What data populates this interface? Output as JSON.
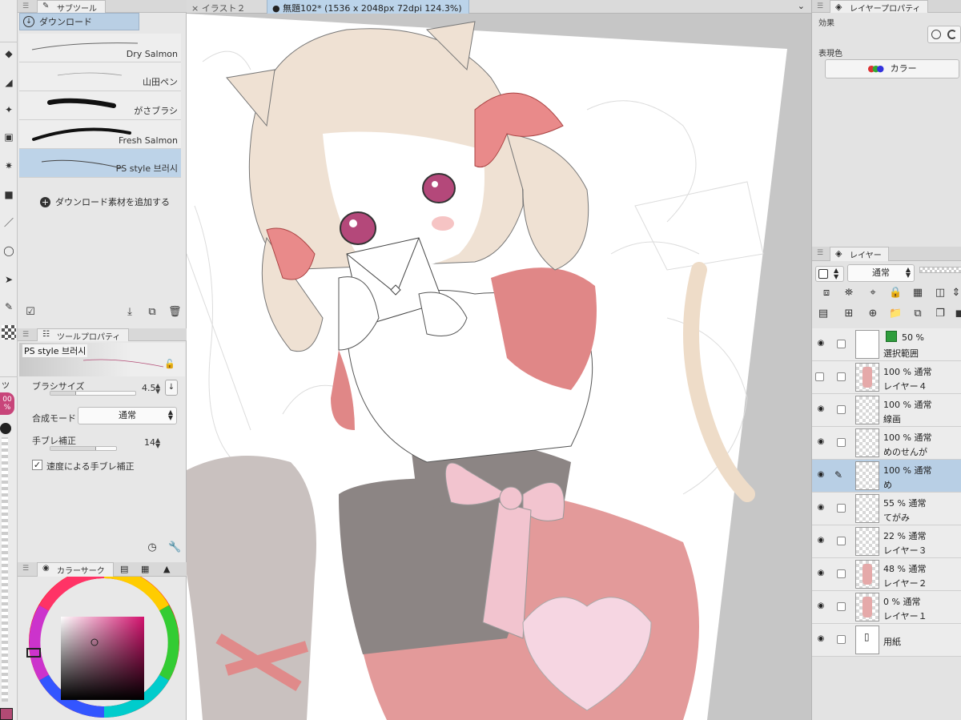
{
  "sub_tool_panel": {
    "tab_label": "サブツール",
    "group_label": "ダウンロード",
    "brushes": [
      {
        "name": "Dry Salmon",
        "selected": false
      },
      {
        "name": "山田ペン",
        "selected": false
      },
      {
        "name": "がさブラシ",
        "selected": false
      },
      {
        "name": "Fresh Salmon",
        "selected": false
      },
      {
        "name": "PS style 브러시",
        "selected": true
      }
    ],
    "add_download_label": "ダウンロード素材を追加する"
  },
  "tool_property_panel": {
    "tab_label": "ツールプロパティ",
    "preview_name": "PS style 브러시",
    "brush_size_label": "ブラシサイズ",
    "brush_size_value": "4.5",
    "brush_size_fraction": 0.3,
    "blend_mode_label": "合成モード",
    "blend_mode_value": "通常",
    "stabilization_label": "手ブレ補正",
    "stabilization_value": "14",
    "stabilization_fraction": 0.7,
    "speed_stabilization_label": "速度による手ブレ補正",
    "speed_stabilization_checked": true
  },
  "color_panel": {
    "tab_label": "カラーサーク",
    "current_color": "#b24a74"
  },
  "toolbar": {
    "partial_tab_label": "ツー",
    "opacity_badge": "00 %"
  },
  "document_tabs": [
    {
      "label": "イラスト２",
      "active": false
    },
    {
      "label": "無題102* (1536 x 2048px 72dpi 124.3%)",
      "active": true
    }
  ],
  "layer_property_panel": {
    "tab_label": "レイヤープロパティ",
    "effect_label": "効果",
    "expression_color_label": "表現色",
    "expression_color_value": "カラー"
  },
  "layer_panel": {
    "tab_label": "レイヤー",
    "blend_mode": "通常",
    "layers": [
      {
        "mode": "50 %",
        "name": "選択範囲",
        "visible": true,
        "thumb": "white",
        "selection": true,
        "selected": false,
        "editing": false
      },
      {
        "mode": "100 %  通常",
        "name": "レイヤー４",
        "visible": false,
        "thumb": "char",
        "selection": false,
        "selected": false,
        "editing": false
      },
      {
        "mode": "100 %  通常",
        "name": "線画",
        "visible": true,
        "thumb": "transparent",
        "selection": false,
        "selected": false,
        "editing": false
      },
      {
        "mode": "100 %  通常",
        "name": "めのせんが",
        "visible": true,
        "thumb": "transparent",
        "selection": false,
        "selected": false,
        "editing": false
      },
      {
        "mode": "100 %  通常",
        "name": "め",
        "visible": true,
        "thumb": "transparent",
        "selection": false,
        "selected": true,
        "editing": true
      },
      {
        "mode": "55 %  通常",
        "name": "てがみ",
        "visible": true,
        "thumb": "transparent",
        "selection": false,
        "selected": false,
        "editing": false
      },
      {
        "mode": "22 %  通常",
        "name": "レイヤー３",
        "visible": true,
        "thumb": "transparent",
        "selection": false,
        "selected": false,
        "editing": false
      },
      {
        "mode": "48 %  通常",
        "name": "レイヤー２",
        "visible": true,
        "thumb": "char",
        "selection": false,
        "selected": false,
        "editing": false
      },
      {
        "mode": "0 %  通常",
        "name": "レイヤー１",
        "visible": true,
        "thumb": "char",
        "selection": false,
        "selected": false,
        "editing": false
      },
      {
        "mode": "",
        "name": "用紙",
        "visible": true,
        "thumb": "white",
        "selection": false,
        "selected": false,
        "editing": false,
        "paper": true
      }
    ]
  }
}
